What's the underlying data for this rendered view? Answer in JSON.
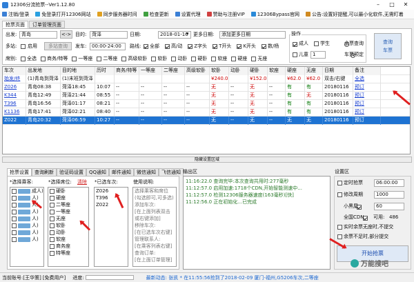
{
  "app": {
    "title": "12306分流抢票--Ver1.12.80"
  },
  "menu": [
    {
      "label": "注销/登录",
      "color": "#3a7fd5"
    },
    {
      "label": "免登录打开12306网站",
      "color": "#2aa0e0"
    },
    {
      "label": "同步服务器时间",
      "color": "#e0a020"
    },
    {
      "label": "检查更新",
      "color": "#40a040"
    },
    {
      "label": "设置代理",
      "color": "#3a7fd5"
    },
    {
      "label": "赞助与注册VIP",
      "color": "#d04040"
    },
    {
      "label": "12306Bypass官网",
      "color": "#2a8ad8"
    },
    {
      "label": "公告:设置好提醒,可以最小化软件,无需盯着",
      "color": "#d08a20"
    }
  ],
  "tabs": {
    "grab": "抢票页面",
    "orders": "订单管理页面"
  },
  "query": {
    "from_label": "出发:",
    "from_value": "青岛",
    "swap": "<->",
    "to_label": "目的:",
    "to_value": "菏泽",
    "date_label": "日期:",
    "date_value": "2018-01-16",
    "more_dates_label": "更多日期:",
    "add_dates": "添加更多日期",
    "multi_label": "多站:",
    "multi_enable": "启用",
    "multi_btn": "多站查询",
    "depart_label": "发车:",
    "depart_value": "00:00-24:00",
    "route_label": "路线:",
    "route_types": [
      "全部",
      "高/动",
      "Z字头",
      "T开头",
      "K开头",
      "数/杨"
    ],
    "seat_label": "席别:",
    "seat_types": [
      "全选",
      "商务/特等",
      "一等座",
      "二等座",
      "高级软卧",
      "软卧",
      "动卧",
      "硬卧",
      "软座",
      "硬座",
      "无座"
    ],
    "passenger_group": "操作",
    "adult": "成人",
    "student": "学生",
    "child": "儿童",
    "child_count": "1",
    "remain_query": "余票查询",
    "reserve": "车票预定",
    "search_btn": "查询\n车票"
  },
  "table": {
    "headers": [
      "车次",
      "出发地",
      "目的地",
      "历时",
      "商务/特等",
      "一等座",
      "二等座",
      "高级软卧",
      "软卧",
      "动卧",
      "硬卧",
      "软座",
      "硬座",
      "无座",
      "日期",
      "备注"
    ],
    "summary": [
      "始发/终",
      "(1)青岛到菏泽",
      "(1)末班到菏泽",
      "",
      "",
      "",
      "",
      "",
      "¥240.0",
      "",
      "¥152.0",
      "",
      "¥62.0",
      "¥62.0",
      "双击/右键",
      "全选"
    ],
    "rows": [
      [
        "Z026",
        "青岛08:38",
        "菏泽18:45",
        "10:07",
        "--",
        "--",
        "--",
        "--",
        "无",
        "--",
        "无",
        "--",
        "有",
        "有",
        "20180116",
        "预订"
      ],
      [
        "K344",
        "青岛12:49",
        "菏泽21:44",
        "08:55",
        "--",
        "--",
        "--",
        "--",
        "无",
        "--",
        "无",
        "--",
        "有",
        "无",
        "20180116",
        "预订"
      ],
      [
        "T396",
        "青岛16:56",
        "菏泽01:17",
        "08:21",
        "--",
        "--",
        "--",
        "--",
        "无",
        "--",
        "无",
        "--",
        "有",
        "有",
        "20180116",
        "预订"
      ],
      [
        "K1136",
        "青岛17:41",
        "菏泽02:21",
        "08:40",
        "--",
        "--",
        "--",
        "--",
        "无",
        "--",
        "无",
        "--",
        "有",
        "有",
        "20180116",
        "预订"
      ],
      [
        "Z022",
        "青岛20:32",
        "菏泽06:59",
        "10:27",
        "--",
        "--",
        "--",
        "--",
        "无",
        "--",
        "无",
        "--",
        "无",
        "无",
        "20180116",
        "预订"
      ]
    ]
  },
  "divider": "隐藏设置区域",
  "settings_tabs": [
    "抢票设置",
    "查询刷新",
    "验证码设置",
    "QQ通知",
    "邮件通知",
    "微信通知",
    "飞信通知"
  ],
  "passengers": {
    "label": "*选择乘客:",
    "items": [
      "成人)",
      "人)",
      "人)",
      "人)",
      "人)",
      "人)",
      "人)",
      "人)"
    ]
  },
  "seats": {
    "label": "*选择席位:",
    "clear": "清除",
    "items": [
      "硬卧",
      "硬座",
      "二等座",
      "一等座",
      "无座",
      "软卧",
      "动卧",
      "软座",
      "商务座",
      "特等座"
    ]
  },
  "trains": {
    "label": "*已选车次:",
    "items": [
      "Z026",
      "T396",
      "Z022"
    ]
  },
  "help": {
    "label": "使用说明:",
    "lines": [
      "选择乘客和席位",
      "(勾选即可,可多选)",
      "添加车次:",
      "[在上面列表双击",
      "或右键添加]",
      "移除车次:",
      "[在已选车次右键]",
      "管理联系人:",
      "[在乘客列表右键]",
      "查询订单:",
      "[在上面订单管理]"
    ]
  },
  "log": {
    "label": "输出区",
    "lines": [
      "11:16:22.0 查询完毕:本次查询共用时:277毫秒",
      "11:12:57.0 启用加速:1718个CDN,开始智能测速中...",
      "11:12:57.0 检测12306服务器速度(163毫秒)[快]",
      "11:12:56.0 正在初始化...已完成"
    ]
  },
  "settings": {
    "label": "设置区",
    "timed": "定时抢票",
    "timed_value": "06:00:00",
    "modify_cycle": "修改周期",
    "modify_value": "1000",
    "blackroom": "小黑屋",
    "blackroom_value": "60",
    "cdn": "全国CDN",
    "available": "可用:",
    "available_value": "486",
    "auto_submit": "实时余票无座时,不提交",
    "partial_submit": "余票不足时,部分提交",
    "start_btn": "开始抢票"
  },
  "status": {
    "account": "当前账号:[王华策]",
    "user_type": "[免费用户]",
    "progress_label": "进度:",
    "news": "最新动态: 张凯 * 在11:55:56抢到了2018-02-09 厦门-福州,G5206车次,二等座"
  },
  "watermark": "万能搜吧"
}
